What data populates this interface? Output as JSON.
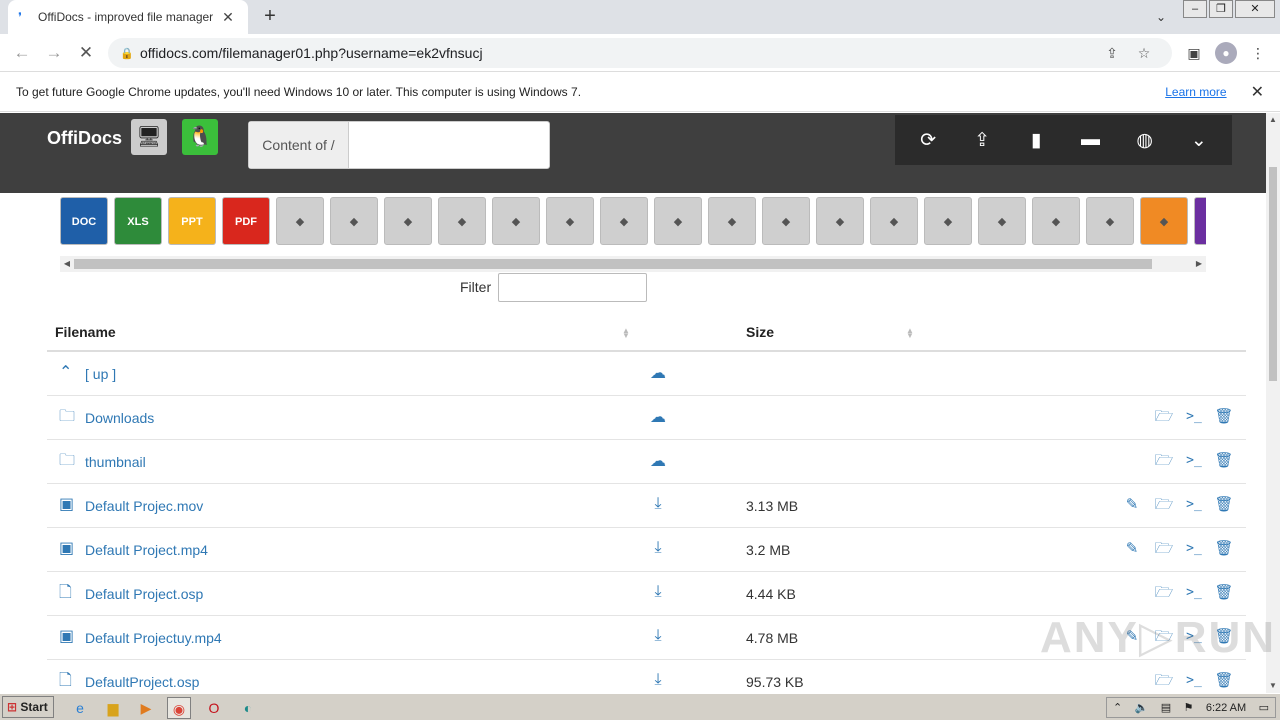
{
  "browser": {
    "tab_title": "OffiDocs - improved file manager",
    "url": "offidocs.com/filemanager01.php?username=ek2vfnsucj",
    "new_tab_symbol": "+",
    "close_symbol": "✕"
  },
  "infobar": {
    "message": "To get future Google Chrome updates, you'll need Windows 10 or later. This computer is using Windows 7.",
    "link": "Learn more"
  },
  "header": {
    "brand": "OffiDocs",
    "path_label": "Content of /",
    "path_value": ""
  },
  "apps": [
    {
      "label": "DOC",
      "color": "#1f5fa8"
    },
    {
      "label": "XLS",
      "color": "#2e8b3a"
    },
    {
      "label": "PPT",
      "color": "#f5b21b"
    },
    {
      "label": "PDF",
      "color": "#d9271d"
    },
    {
      "label": "",
      "color": "#cfcfcf",
      "icon": "gimp-icon"
    },
    {
      "label": "",
      "color": "#cfcfcf",
      "icon": "inkscape-icon"
    },
    {
      "label": "",
      "color": "#cfcfcf",
      "icon": "drawio-icon"
    },
    {
      "label": "",
      "color": "#cfcfcf",
      "icon": "audacity-icon"
    },
    {
      "label": "",
      "color": "#cfcfcf",
      "icon": "openshot-icon"
    },
    {
      "label": "",
      "color": "#cfcfcf",
      "icon": "lmms-icon"
    },
    {
      "label": "",
      "color": "#cfcfcf",
      "icon": "openshot-alt-icon"
    },
    {
      "label": "",
      "color": "#cfcfcf",
      "icon": "headphones-icon"
    },
    {
      "label": "",
      "color": "#cfcfcf",
      "icon": "draw-icon"
    },
    {
      "label": "",
      "color": "#cfcfcf",
      "icon": "eclipse-icon"
    },
    {
      "label": "",
      "color": "#cfcfcf",
      "icon": "cards-icon"
    },
    {
      "label": "",
      "color": "#cfcfcf",
      "icon": "gantt-icon"
    },
    {
      "label": "",
      "color": "#cfcfcf",
      "icon": "globe-icon"
    },
    {
      "label": "",
      "color": "#cfcfcf",
      "icon": "mail-icon"
    },
    {
      "label": "",
      "color": "#cfcfcf",
      "icon": "chess-icon"
    },
    {
      "label": "",
      "color": "#cfcfcf",
      "icon": "abacus-icon"
    },
    {
      "label": "",
      "color": "#f08a24",
      "icon": "video-edit-icon"
    },
    {
      "label": "",
      "color": "#6b2fa0",
      "icon": "partial-icon"
    }
  ],
  "filter": {
    "label": "Filter",
    "value": ""
  },
  "table": {
    "col_filename": "Filename",
    "col_size": "Size",
    "rows": [
      {
        "name": "[ up ]",
        "type": "up",
        "size": "",
        "actions": []
      },
      {
        "name": "Downloads",
        "type": "folder",
        "size": "",
        "actions": [
          "open",
          "cmd",
          "delete"
        ]
      },
      {
        "name": "thumbnail",
        "type": "folder",
        "size": "",
        "actions": [
          "open",
          "cmd",
          "delete"
        ]
      },
      {
        "name": "Default Projec.mov",
        "type": "video",
        "size": "3.13 MB",
        "actions": [
          "edit",
          "open",
          "cmd",
          "delete"
        ]
      },
      {
        "name": "Default Project.mp4",
        "type": "video",
        "size": "3.2 MB",
        "actions": [
          "edit",
          "open",
          "cmd",
          "delete"
        ]
      },
      {
        "name": "Default Project.osp",
        "type": "file",
        "size": "4.44 KB",
        "actions": [
          "open",
          "cmd",
          "delete"
        ]
      },
      {
        "name": "Default Projectuy.mp4",
        "type": "video",
        "size": "4.78 MB",
        "actions": [
          "edit",
          "open",
          "cmd",
          "delete"
        ]
      },
      {
        "name": "DefaultProject.osp",
        "type": "file",
        "size": "95.73 KB",
        "actions": [
          "open",
          "cmd",
          "delete"
        ]
      }
    ]
  },
  "taskbar": {
    "start": "Start",
    "time": "6:22 AM"
  }
}
